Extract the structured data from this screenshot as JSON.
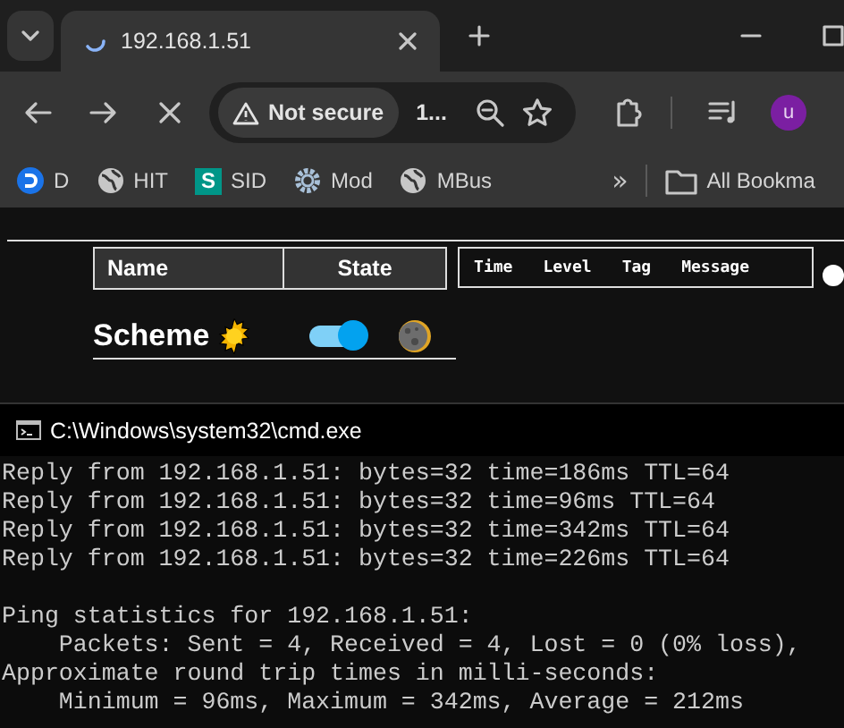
{
  "browser": {
    "tab": {
      "title": "192.168.1.51",
      "loading": true
    },
    "address": {
      "security": "Not secure",
      "url": "1..."
    },
    "profile": "u",
    "bookmarks": [
      {
        "label": "D",
        "kind": "disc"
      },
      {
        "label": "HIT",
        "kind": "globe"
      },
      {
        "label": "SID",
        "kind": "letter",
        "letter": "S"
      },
      {
        "label": "Mod",
        "kind": "gear"
      },
      {
        "label": "MBus",
        "kind": "globe"
      }
    ],
    "more": "»",
    "all_bookmarks": "All Bookma"
  },
  "page": {
    "table_columns": [
      "Name",
      "State"
    ],
    "log_columns": [
      "Time",
      "Level",
      "Tag",
      "Message"
    ],
    "scheme": {
      "label": "Scheme",
      "on": true
    }
  },
  "console": {
    "title": "C:\\Windows\\system32\\cmd.exe",
    "replies": [
      "Reply from 192.168.1.51: bytes=32 time=186ms TTL=64",
      "Reply from 192.168.1.51: bytes=32 time=96ms TTL=64",
      "Reply from 192.168.1.51: bytes=32 time=342ms TTL=64",
      "Reply from 192.168.1.51: bytes=32 time=226ms TTL=64"
    ],
    "statistics": [
      "Ping statistics for 192.168.1.51:",
      "    Packets: Sent = 4, Received = 4, Lost = 0 (0% loss),",
      "Approximate round trip times in milli-seconds:",
      "    Minimum = 96ms, Maximum = 342ms, Average = 212ms"
    ]
  }
}
